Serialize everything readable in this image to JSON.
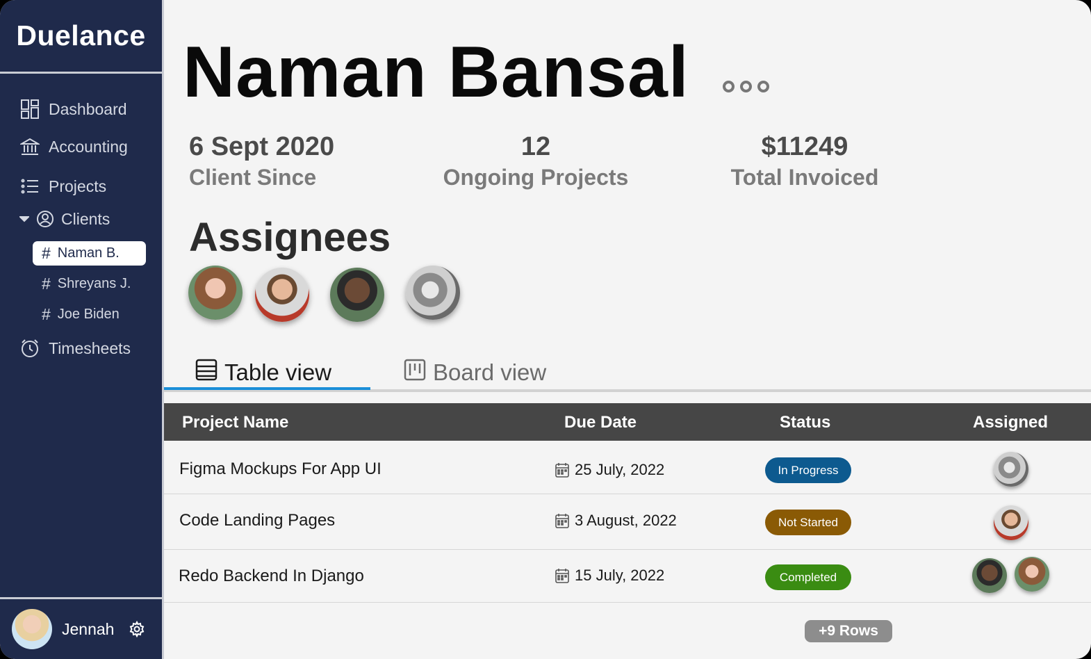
{
  "app": {
    "brand": "Duelance"
  },
  "sidebar": {
    "items": [
      {
        "label": "Dashboard",
        "icon": "dashboard-icon"
      },
      {
        "label": "Accounting",
        "icon": "bank-icon"
      },
      {
        "label": "Projects",
        "icon": "list-icon"
      },
      {
        "label": "Clients",
        "icon": "user-circle-icon"
      },
      {
        "label": "Timesheets",
        "icon": "alarm-clock-icon"
      }
    ],
    "clients": [
      {
        "label": "Naman B.",
        "active": true
      },
      {
        "label": "Shreyans J.",
        "active": false
      },
      {
        "label": "Joe Biden",
        "active": false
      }
    ],
    "hash": "#",
    "user": {
      "name": "Jennah"
    }
  },
  "client": {
    "name": "Naman Bansal",
    "stats": [
      {
        "value": "6 Sept 2020",
        "label": "Client Since"
      },
      {
        "value": "12",
        "label": "Ongoing Projects"
      },
      {
        "value": "$11249",
        "label": "Total Invoiced"
      }
    ]
  },
  "assignees": {
    "title": "Assignees"
  },
  "tabs": [
    {
      "label": "Table view",
      "active": true
    },
    {
      "label": "Board view",
      "active": false
    }
  ],
  "table": {
    "headers": [
      "Project Name",
      "Due Date",
      "Status",
      "Assigned"
    ],
    "rows": [
      {
        "name": "Figma Mockups For App UI",
        "due": "25 July, 2022",
        "status": "In Progress",
        "status_color": "#0d5a8f"
      },
      {
        "name": "Code Landing Pages",
        "due": "3 August, 2022",
        "status": "Not Started",
        "status_color": "#8a5a05"
      },
      {
        "name": "Redo Backend In Django",
        "due": "15 July, 2022",
        "status": "Completed",
        "status_color": "#3a8c12"
      }
    ],
    "more_rows": "+9 Rows"
  },
  "colors": {
    "sidebar": "#1f2a4b",
    "accent": "#1b8ed8",
    "header": "#464646"
  }
}
